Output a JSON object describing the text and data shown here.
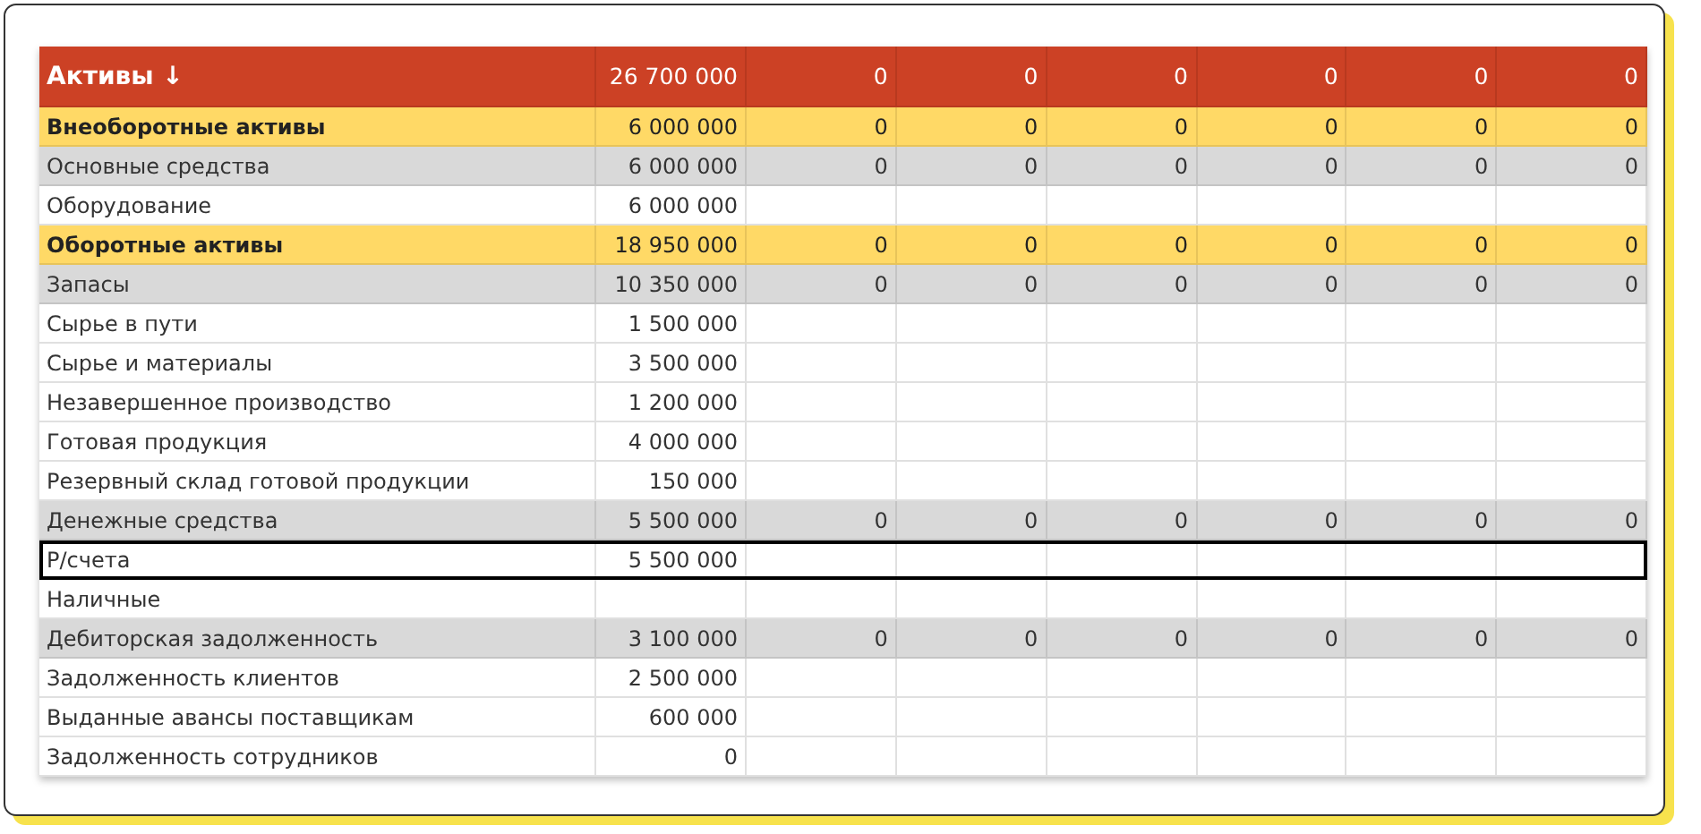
{
  "table": {
    "header": {
      "label": "Активы ↓",
      "total": "26 700 000",
      "periods": [
        "0",
        "0",
        "0",
        "0",
        "0",
        "0"
      ]
    },
    "rows": [
      {
        "kind": "group",
        "label": "Внеоборотные активы",
        "total": "6 000 000",
        "periods": [
          "0",
          "0",
          "0",
          "0",
          "0",
          "0"
        ],
        "selected": false
      },
      {
        "kind": "subtotal",
        "label": "Основные средства",
        "total": "6 000 000",
        "periods": [
          "0",
          "0",
          "0",
          "0",
          "0",
          "0"
        ],
        "selected": false
      },
      {
        "kind": "item",
        "label": "Оборудование",
        "total": "6 000 000",
        "selected": false
      },
      {
        "kind": "group",
        "label": "Оборотные активы",
        "total": "18 950 000",
        "periods": [
          "0",
          "0",
          "0",
          "0",
          "0",
          "0"
        ],
        "selected": false
      },
      {
        "kind": "subtotal",
        "label": "Запасы",
        "total": "10 350 000",
        "periods": [
          "0",
          "0",
          "0",
          "0",
          "0",
          "0"
        ],
        "selected": false
      },
      {
        "kind": "item",
        "label": "Сырье в пути",
        "total": "1 500 000",
        "selected": false
      },
      {
        "kind": "item",
        "label": "Сырье и материалы",
        "total": "3 500 000",
        "selected": false
      },
      {
        "kind": "item",
        "label": "Незавершенное производство",
        "total": "1 200 000",
        "selected": false
      },
      {
        "kind": "item",
        "label": "Готовая продукция",
        "total": "4 000 000",
        "selected": false
      },
      {
        "kind": "item",
        "label": "Резервный склад готовой продукции",
        "total": "150 000",
        "selected": false
      },
      {
        "kind": "subtotal",
        "label": "Денежные средства",
        "total": "5 500 000",
        "periods": [
          "0",
          "0",
          "0",
          "0",
          "0",
          "0"
        ],
        "selected": false
      },
      {
        "kind": "item",
        "label": "Р/счета",
        "total": "5 500 000",
        "selected": true
      },
      {
        "kind": "item",
        "label": "Наличные",
        "selected": false
      },
      {
        "kind": "subtotal",
        "label": "Дебиторская задолженность",
        "total": "3 100 000",
        "periods": [
          "0",
          "0",
          "0",
          "0",
          "0",
          "0"
        ],
        "selected": false
      },
      {
        "kind": "item",
        "label": "Задолженность клиентов",
        "total": "2 500 000",
        "selected": false
      },
      {
        "kind": "item",
        "label": "Выданные авансы поставщикам",
        "total": "600 000",
        "selected": false
      },
      {
        "kind": "item",
        "label": "Задолженность сотрудников",
        "total": "0",
        "selected": false
      }
    ]
  }
}
